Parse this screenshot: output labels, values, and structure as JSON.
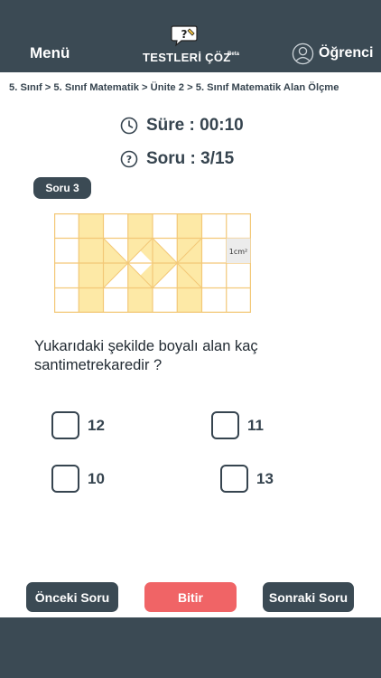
{
  "header": {
    "menu_label": "Menü",
    "logo_text": "TESTLERİ ÇÖZ",
    "logo_badge": "Beta",
    "user_label": "Öğrenci"
  },
  "breadcrumb": "5. Sınıf > 5. Sınıf Matematik > Ünite 2 > 5. Sınıf Matematik Alan Ölçme",
  "status": {
    "timer": "Süre : 00:10",
    "question_count": "Soru : 3/15"
  },
  "question": {
    "badge": "Soru 3",
    "figure_label": "1cm²",
    "text": "Yukarıdaki şekilde boyalı alan kaç santimetrekaredir ?",
    "options": [
      {
        "label": "12"
      },
      {
        "label": "11"
      },
      {
        "label": "10"
      },
      {
        "label": "13"
      }
    ]
  },
  "footer": {
    "prev_label": "Önceki Soru",
    "finish_label": "Bitir",
    "next_label": "Sonraki Soru"
  },
  "colors": {
    "primary": "#3b4a54",
    "finish": "#f06466",
    "shaded": "#fde9a6"
  }
}
